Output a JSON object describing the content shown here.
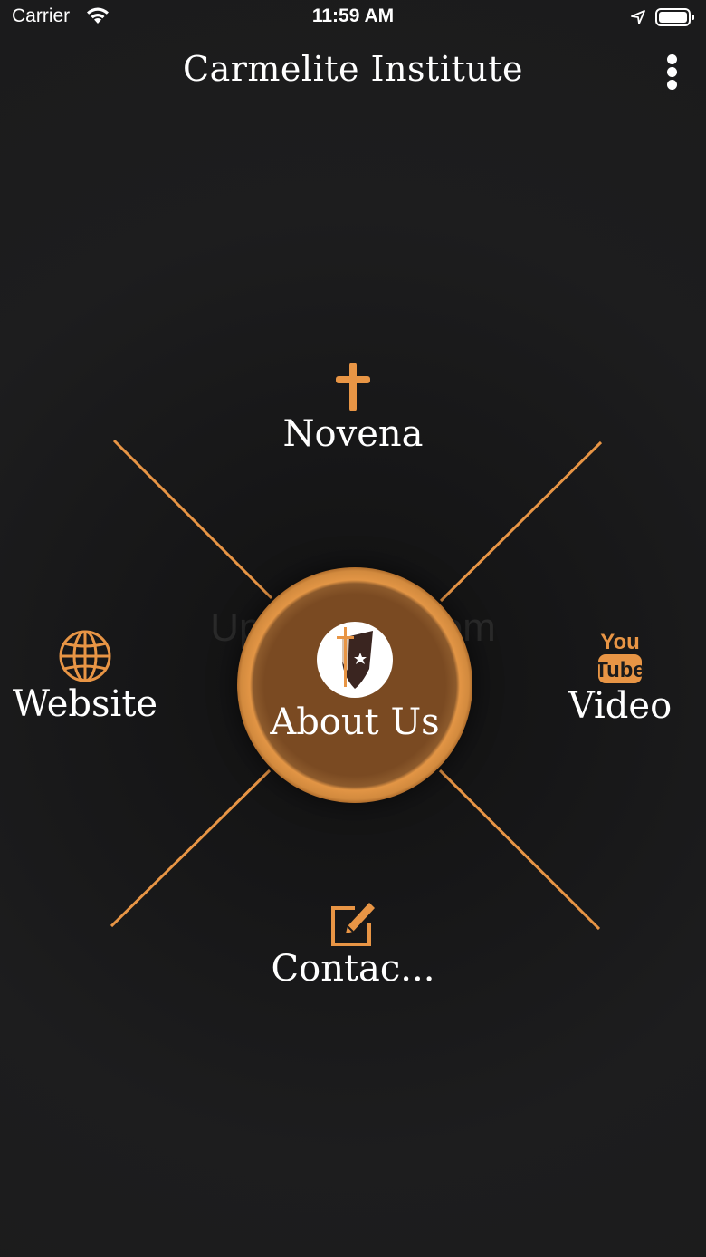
{
  "status_bar": {
    "carrier": "Carrier",
    "time": "11:59 AM"
  },
  "nav": {
    "title": "Carmelite Institute"
  },
  "menu": {
    "top": {
      "label": "Novena",
      "icon": "cross-icon"
    },
    "left": {
      "label": "Website",
      "icon": "globe-icon"
    },
    "right": {
      "label": "Video",
      "icon": "youtube-icon",
      "icon_text_top": "You",
      "icon_text_bottom": "Tube"
    },
    "bottom": {
      "label": "Contac...",
      "icon": "edit-icon"
    },
    "center": {
      "label": "About Us",
      "icon": "carmelite-logo"
    }
  },
  "watermark": "UpdateStar.com",
  "colors": {
    "accent": "#e89545",
    "background": "#1b1b1c",
    "center_fill": "#7a4a22"
  }
}
